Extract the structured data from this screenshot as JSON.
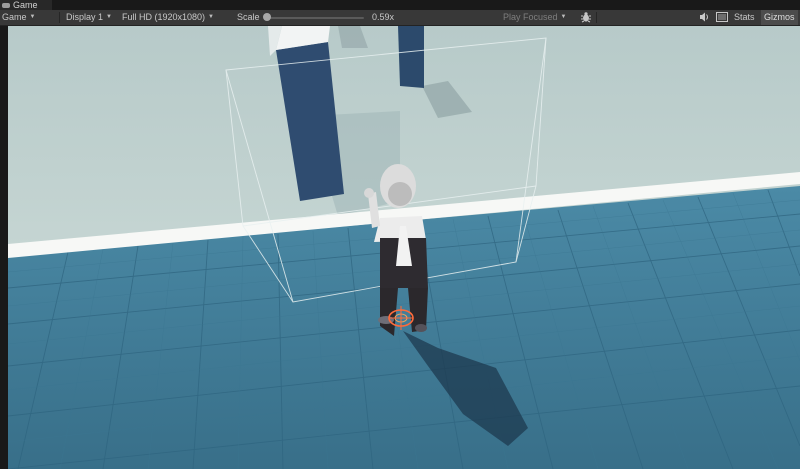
{
  "window": {
    "tab_label": "Game"
  },
  "toolbar": {
    "view_mode": "Game",
    "display": "Display 1",
    "resolution": "Full HD (1920x1080)",
    "scale_label": "Scale",
    "scale_value": "0.59x",
    "scale_fraction": 0.0,
    "play_mode": "Play Focused",
    "stats_label": "Stats",
    "gizmos_label": "Gizmos"
  },
  "icons": {
    "tab": "gamepad-icon",
    "bug": "bug-icon",
    "audio": "speaker-icon",
    "stats_layout": "grid-icon"
  },
  "colors": {
    "floor": "#3f7b98",
    "background": "#c1d2d1",
    "walls": "#2e4a6d",
    "gizmo_ring": "#ff6b3b"
  }
}
